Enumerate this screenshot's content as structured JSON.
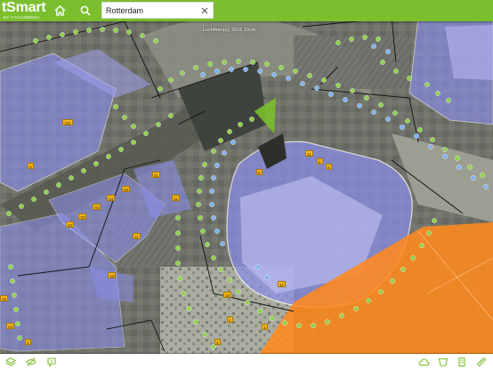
{
  "app": {
    "brand_title": "tSmart",
    "brand_subtitle": "BY CYCLOMEDIA"
  },
  "toolbar": {
    "home_icon": "home-icon",
    "search_icon": "search-icon"
  },
  "search": {
    "value": "Rotterdam",
    "placeholder": "",
    "clear_icon": "close-icon"
  },
  "map": {
    "caption": "Luchtfoto(s), 2016 10cm",
    "colors": {
      "accent": "#7bbf2e",
      "building_overlay": "#8a8ee8",
      "orange_area": "#ff8a1e",
      "panorama_green": "#8fd14a",
      "panorama_blue": "#7fb2f0",
      "label_yellow": "#f3b517"
    },
    "labels": [
      "122",
      "3",
      "40",
      "70",
      "70",
      "13",
      "20",
      "31",
      "11",
      "11",
      "13",
      "11",
      "6",
      "6",
      "9",
      "11",
      "15",
      "18",
      "22",
      "4",
      "4",
      "1",
      "4"
    ]
  },
  "bottom_toolbar": {
    "left": [
      "layers-icon",
      "hide-icon",
      "info-icon"
    ],
    "right": [
      "cloud-icon",
      "shape-icon",
      "building-icon",
      "measure-icon"
    ]
  }
}
